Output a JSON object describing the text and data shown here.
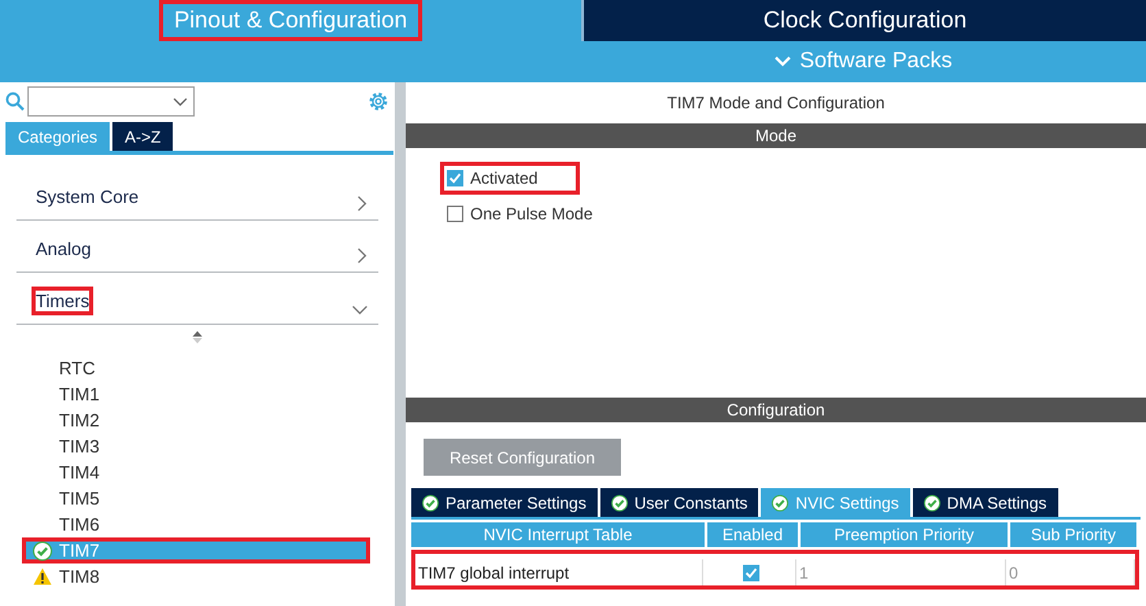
{
  "top_tabs": [
    {
      "label": "Pinout & Configuration",
      "selected": true,
      "highlighted": true
    },
    {
      "label": "Clock Configuration",
      "selected": false,
      "highlighted": false
    }
  ],
  "menu": {
    "label": "Software Packs"
  },
  "sidebar": {
    "tabs": [
      {
        "label": "Categories",
        "selected": true
      },
      {
        "label": "A->Z",
        "selected": false
      }
    ],
    "categories": [
      {
        "label": "System Core",
        "expanded": false,
        "highlighted": false
      },
      {
        "label": "Analog",
        "expanded": false,
        "highlighted": false
      },
      {
        "label": "Timers",
        "expanded": true,
        "highlighted": true,
        "children": [
          {
            "label": "RTC",
            "kind": "plain",
            "selected": false,
            "highlighted": false
          },
          {
            "label": "TIM1",
            "kind": "plain",
            "selected": false,
            "highlighted": false
          },
          {
            "label": "TIM2",
            "kind": "plain",
            "selected": false,
            "highlighted": false
          },
          {
            "label": "TIM3",
            "kind": "plain",
            "selected": false,
            "highlighted": false
          },
          {
            "label": "TIM4",
            "kind": "plain",
            "selected": false,
            "highlighted": false
          },
          {
            "label": "TIM5",
            "kind": "plain",
            "selected": false,
            "highlighted": false
          },
          {
            "label": "TIM6",
            "kind": "plain",
            "selected": false,
            "highlighted": false
          },
          {
            "label": "TIM7",
            "kind": "ok",
            "selected": true,
            "highlighted": true
          },
          {
            "label": "TIM8",
            "kind": "warning",
            "selected": false,
            "highlighted": false
          }
        ]
      }
    ]
  },
  "panel": {
    "title": "TIM7 Mode and Configuration",
    "mode": {
      "header": "Mode",
      "options": [
        {
          "label": "Activated",
          "checked": true,
          "highlighted": true
        },
        {
          "label": "One Pulse Mode",
          "checked": false,
          "highlighted": false
        }
      ]
    },
    "configuration": {
      "header": "Configuration",
      "reset_button": "Reset Configuration",
      "tabs": [
        {
          "label": "Parameter Settings",
          "selected": false
        },
        {
          "label": "User Constants",
          "selected": false
        },
        {
          "label": "NVIC Settings",
          "selected": true
        },
        {
          "label": "DMA Settings",
          "selected": false
        }
      ],
      "table": {
        "columns": [
          "NVIC Interrupt Table",
          "Enabled",
          "Preemption Priority",
          "Sub Priority"
        ],
        "rows": [
          {
            "name": "TIM7 global interrupt",
            "enabled": true,
            "preemption_priority": "1",
            "sub_priority": "0",
            "highlighted": true
          }
        ]
      }
    }
  }
}
